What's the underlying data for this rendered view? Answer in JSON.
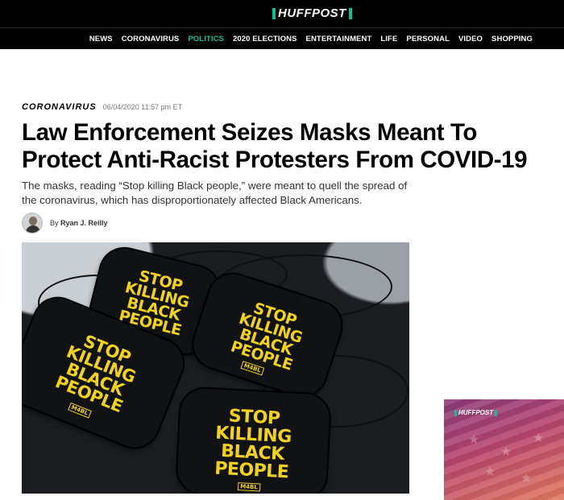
{
  "header": {
    "logo_text": "HUFFPOST",
    "nav": [
      {
        "label": "NEWS",
        "active": false
      },
      {
        "label": "CORONAVIRUS",
        "active": false
      },
      {
        "label": "POLITICS",
        "active": true
      },
      {
        "label": "2020 ELECTIONS",
        "active": false
      },
      {
        "label": "ENTERTAINMENT",
        "active": false
      },
      {
        "label": "LIFE",
        "active": false
      },
      {
        "label": "PERSONAL",
        "active": false
      },
      {
        "label": "VIDEO",
        "active": false
      },
      {
        "label": "SHOPPING",
        "active": false
      }
    ]
  },
  "article": {
    "section": "CORONAVIRUS",
    "timestamp": "06/04/2020 11:57 pm ET",
    "headline": "Law Enforcement Seizes Masks Meant To Protect Anti-Racist Protesters From COVID-19",
    "dek": "The masks, reading “Stop killing Black people,” were meant to quell the spread of the coronavirus, which has disproportionately affected Black Americans.",
    "byline_prefix": "By",
    "author": "Ryan J. Reilly"
  },
  "photo": {
    "mask_texts": [
      "STOP KILLING BLACK PEOPLE",
      "STOP KILLING BLACK PEOPLE",
      "STOP KILLING BLACK PEOPLE",
      "STOP KILLING BLACK PEOPLE"
    ],
    "mask_lines": [
      "STOP",
      "KILLING",
      "BLACK",
      "PEOPLE"
    ],
    "brand": "M4BL"
  },
  "ad": {
    "logo_text": "HUFFPOST"
  },
  "colors": {
    "accent": "#0dbe98",
    "mask_print": "#f2d21b",
    "header_bg": "#000000"
  }
}
